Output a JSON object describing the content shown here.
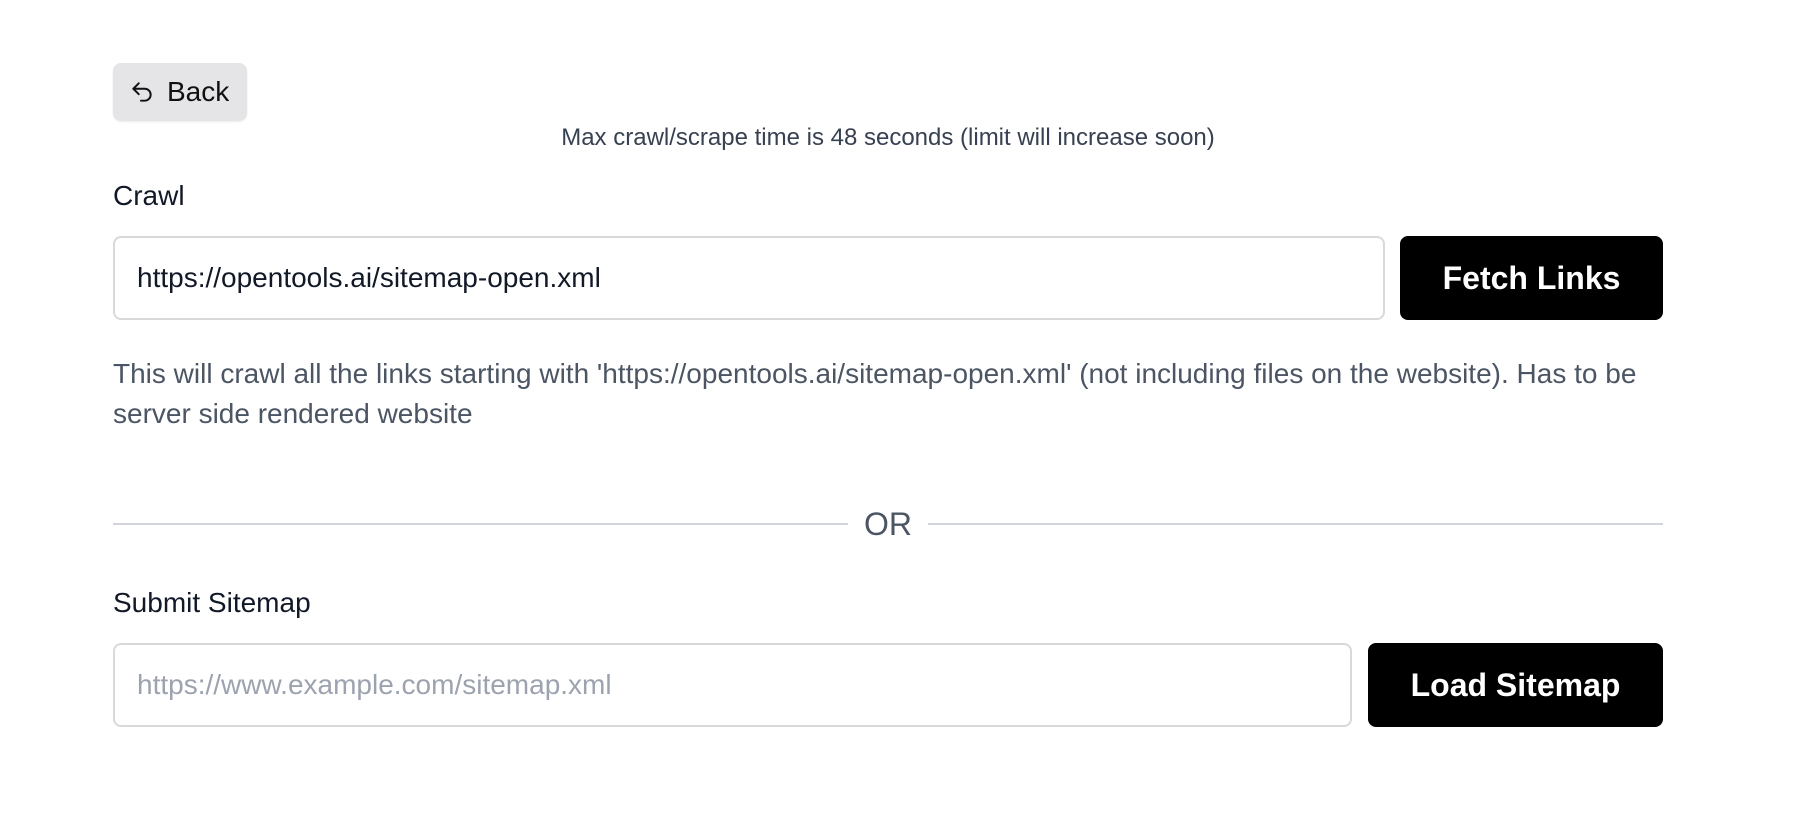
{
  "back_button": {
    "label": "Back",
    "icon": "undo-arrow-icon"
  },
  "notice": "Max crawl/scrape time is 48 seconds (limit will increase soon)",
  "crawl": {
    "label": "Crawl",
    "input_value": "https://opentools.ai/sitemap-open.xml",
    "button_label": "Fetch Links",
    "helper_text": "This will crawl all the links starting with 'https://opentools.ai/sitemap-open.xml' (not including files on the website). Has to be server side rendered website"
  },
  "divider": {
    "text": "OR"
  },
  "sitemap": {
    "label": "Submit Sitemap",
    "input_placeholder": "https://www.example.com/sitemap.xml",
    "input_value": "",
    "button_label": "Load Sitemap"
  },
  "colors": {
    "primary_button_bg": "#000000",
    "primary_button_text": "#ffffff",
    "back_button_bg": "#e5e5e7",
    "border": "#d9d9dc",
    "muted_text": "#4b5563",
    "placeholder": "#9ca3af"
  }
}
